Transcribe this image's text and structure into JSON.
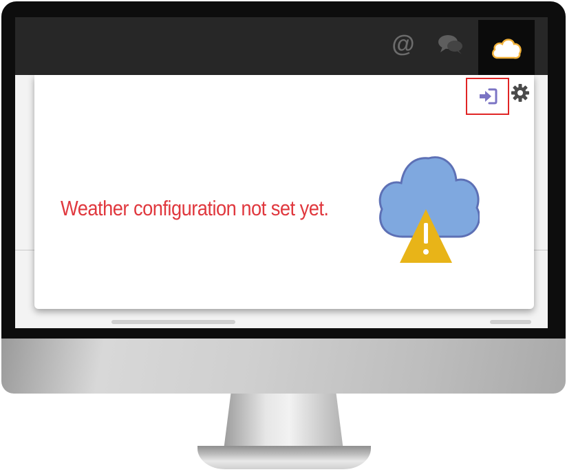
{
  "topbar": {
    "mention_icon": "@",
    "icons": [
      "at-icon",
      "chat-bubbles-icon",
      "cloud-icon"
    ]
  },
  "weather_panel": {
    "message": "Weather configuration not set yet.",
    "message_color": "#e0383e",
    "signin_icon": "sign-in-icon",
    "settings_icon": "gear-icon",
    "highlight_color": "#e02424",
    "status_icon": "cloud-warning-icon"
  }
}
